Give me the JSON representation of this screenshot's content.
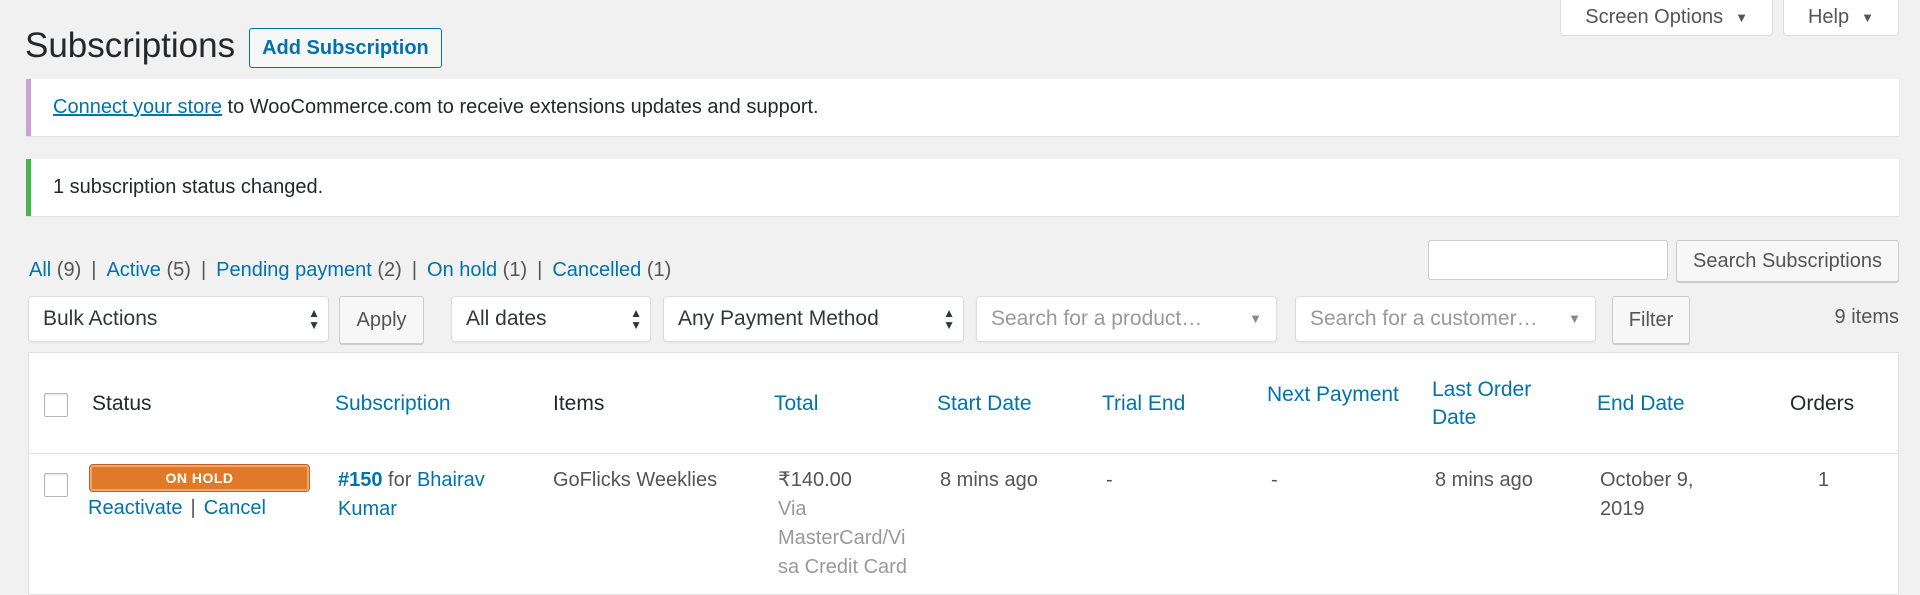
{
  "meta": {
    "screen_options_label": "Screen Options",
    "help_label": "Help"
  },
  "header": {
    "title": "Subscriptions",
    "add_label": "Add Subscription"
  },
  "notices": {
    "connect_link": "Connect your store",
    "connect_text": " to WooCommerce.com to receive extensions updates and support.",
    "success_text": "1 subscription status changed."
  },
  "search": {
    "value": "",
    "button_label": "Search Subscriptions"
  },
  "status_filters": [
    {
      "label": "All",
      "count": "(9)"
    },
    {
      "label": "Active",
      "count": "(5)"
    },
    {
      "label": "Pending payment",
      "count": "(2)"
    },
    {
      "label": "On hold",
      "count": "(1)"
    },
    {
      "label": "Cancelled",
      "count": "(1)"
    }
  ],
  "separator": "|",
  "tablenav": {
    "bulk_actions": "Bulk Actions",
    "apply_label": "Apply",
    "dates": "All dates",
    "payment_method": "Any Payment Method",
    "product_placeholder": "Search for a product…",
    "customer_placeholder": "Search for a customer…",
    "filter_label": "Filter",
    "items_count": "9 items"
  },
  "columns": {
    "status": "Status",
    "subscription": "Subscription",
    "items": "Items",
    "total": "Total",
    "start_date": "Start Date",
    "trial_end": "Trial End",
    "next_payment": "Next Payment",
    "last_order_date_1": "Last Order",
    "last_order_date_2": "Date",
    "end_date": "End Date",
    "orders": "Orders"
  },
  "rows": [
    {
      "status": "ON HOLD",
      "action_reactivate": "Reactivate",
      "action_cancel": "Cancel",
      "sub_number": "#150",
      "sub_for": " for ",
      "customer_1": "Bhairav",
      "customer_2": "Kumar",
      "item": "GoFlicks Weeklies",
      "total": "₹140.00",
      "via_1": "Via",
      "via_2": "MasterCard/Vi",
      "via_3": "sa Credit Card",
      "start_date": "8 mins ago",
      "trial_end": "-",
      "next_payment": "-",
      "last_order_date": "8 mins ago",
      "end_date_1": "October 9,",
      "end_date_2": "2019",
      "orders": "1"
    }
  ],
  "colors": {
    "accent": "#0073aa",
    "on_hold": "#e07a29",
    "success": "#46b450",
    "connect_border": "#c9a3d5"
  },
  "icons": {
    "dropdown": "triangle-down-icon",
    "select_arrows": "updown-arrows-icon"
  }
}
